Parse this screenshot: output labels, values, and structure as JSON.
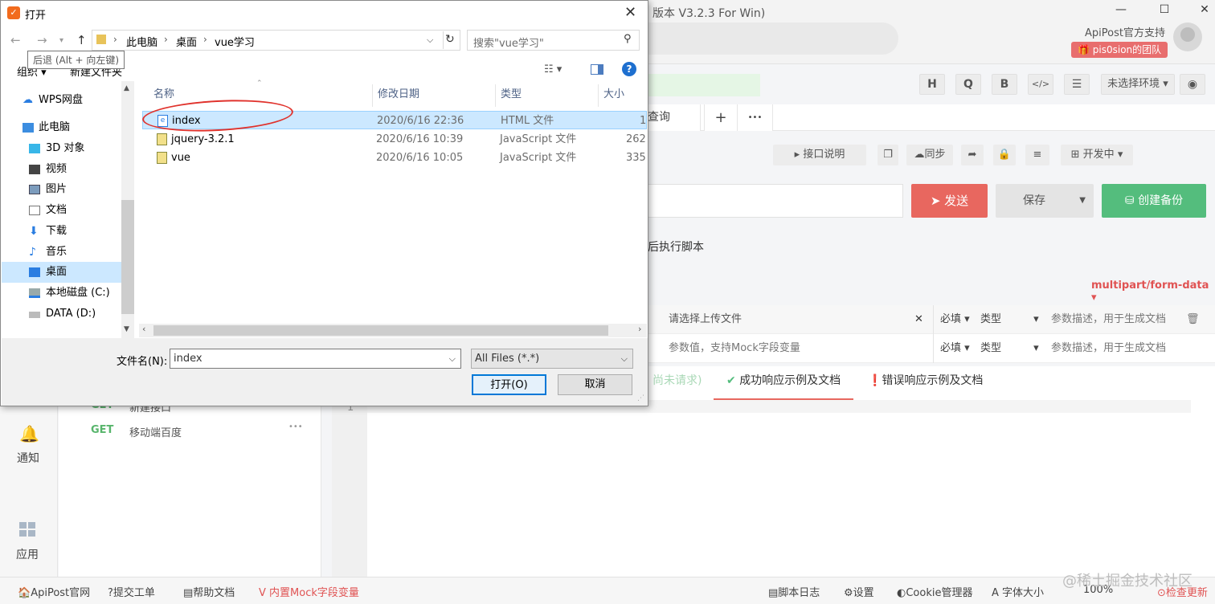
{
  "app": {
    "title_fragment": "版本 V3.2.3 For Win)",
    "official_support": "ApiPost官方支持",
    "team_badge": "pis0sion的团队",
    "toolbar_letters": [
      "H",
      "Q",
      "B",
      "</>",
      "☰"
    ],
    "env_select": "未选择环境",
    "tab_partial": "查询",
    "tab_add": "+",
    "tab_more": "•••",
    "api_desc_btn": "接口说明",
    "sync_btn": "同步",
    "dev_status": "开发中",
    "send_btn": "发送",
    "save_btn": "保存",
    "backup_btn": "创建备份",
    "exec_script_label": "后执行脚本",
    "content_type": "multipart/form-data",
    "param_rows": [
      {
        "value": "请选择上传文件",
        "required": "必填",
        "type": "类型",
        "desc": "参数描述，用于生成文档"
      },
      {
        "value": "参数值，支持Mock字段变量",
        "required": "必填",
        "type": "类型",
        "desc": "参数描述，用于生成文档"
      }
    ],
    "resp_tabs": {
      "pending": "尚未请求)",
      "success": "成功响应示例及文档",
      "error": "错误响应示例及文档"
    },
    "line_number": "1",
    "left_nav": {
      "notify": "通知",
      "apps": "应用"
    },
    "api_list": [
      {
        "method": "GET",
        "name": "新建接口"
      },
      {
        "method": "GET",
        "name": "移动端百度"
      }
    ],
    "statusbar": {
      "official": "ApiPost官网",
      "ticket": "提交工单",
      "help": "帮助文档",
      "mock": "内置Mock字段变量",
      "script_log": "脚本日志",
      "settings": "设置",
      "cookie": "Cookie管理器",
      "font": "字体大小",
      "zoom": "100%",
      "update": "检查更新"
    },
    "watermark": "@稀土掘金技术社区"
  },
  "dialog": {
    "title": "打开",
    "close": "✕",
    "breadcrumb": [
      "此电脑",
      "桌面",
      "vue学习"
    ],
    "search_placeholder": "搜索\"vue学习\"",
    "tooltip": "后退 (Alt + 向左键)",
    "organize": "组织",
    "new_folder": "新建文件夹",
    "nav_items": [
      {
        "label": "WPS网盘"
      },
      {
        "label": "此电脑"
      },
      {
        "label": "3D 对象"
      },
      {
        "label": "视频"
      },
      {
        "label": "图片"
      },
      {
        "label": "文档"
      },
      {
        "label": "下载"
      },
      {
        "label": "音乐"
      },
      {
        "label": "桌面"
      },
      {
        "label": "本地磁盘 (C:)"
      },
      {
        "label": "DATA (D:)"
      }
    ],
    "columns": {
      "name": "名称",
      "date": "修改日期",
      "type": "类型",
      "size": "大小"
    },
    "files": [
      {
        "name": "index",
        "date": "2020/6/16 22:36",
        "type": "HTML 文件",
        "size": "1"
      },
      {
        "name": "jquery-3.2.1",
        "date": "2020/6/16 10:39",
        "type": "JavaScript 文件",
        "size": "262"
      },
      {
        "name": "vue",
        "date": "2020/6/16 10:05",
        "type": "JavaScript 文件",
        "size": "335"
      }
    ],
    "filename_label": "文件名(N):",
    "filename_value": "index",
    "filetype": "All Files (*.*)",
    "open_btn": "打开(O)",
    "cancel_btn": "取消"
  },
  "colors": {
    "send": "#e8675f",
    "backup": "#54bd7d",
    "selection": "#cce8ff",
    "annotation": "#e0322c"
  }
}
